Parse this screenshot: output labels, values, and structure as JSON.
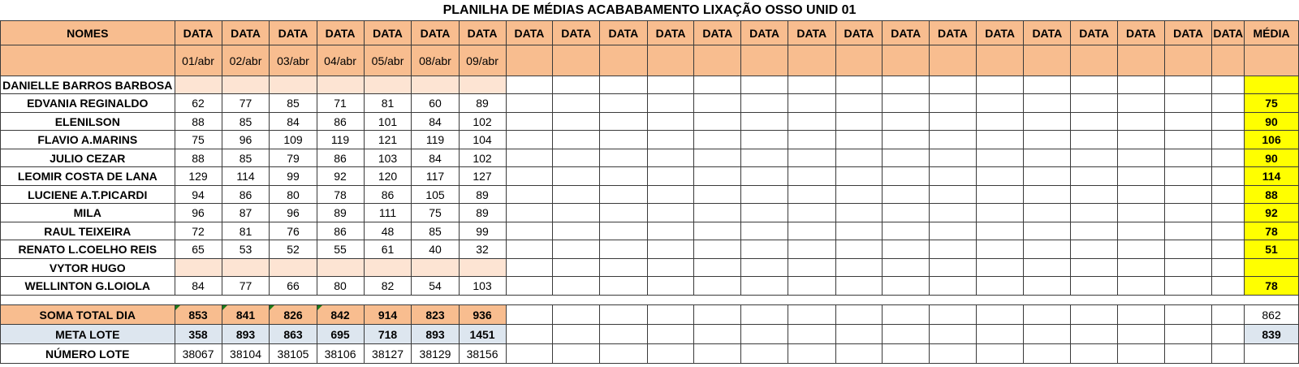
{
  "title": "PLANILHA DE MÉDIAS ACABABAMENTO LIXAÇÃO OSSO UNID 01",
  "header": {
    "names_label": "NOMES",
    "data_label": "DATA",
    "media_label": "MÉDIA",
    "dates": [
      "01/abr",
      "02/abr",
      "03/abr",
      "04/abr",
      "05/abr",
      "08/abr",
      "09/abr"
    ]
  },
  "rows": [
    {
      "name": "DANIELLE BARROS BARBOSA",
      "values": [
        "",
        "",
        "",
        "",
        "",
        "",
        ""
      ],
      "avg": ""
    },
    {
      "name": "EDVANIA REGINALDO",
      "values": [
        "62",
        "77",
        "85",
        "71",
        "81",
        "60",
        "89"
      ],
      "avg": "75"
    },
    {
      "name": "ELENILSON",
      "values": [
        "88",
        "85",
        "84",
        "86",
        "101",
        "84",
        "102"
      ],
      "avg": "90"
    },
    {
      "name": "FLAVIO A.MARINS",
      "values": [
        "75",
        "96",
        "109",
        "119",
        "121",
        "119",
        "104"
      ],
      "avg": "106"
    },
    {
      "name": "JULIO CEZAR",
      "values": [
        "88",
        "85",
        "79",
        "86",
        "103",
        "84",
        "102"
      ],
      "avg": "90"
    },
    {
      "name": "LEOMIR COSTA DE LANA",
      "values": [
        "129",
        "114",
        "99",
        "92",
        "120",
        "117",
        "127"
      ],
      "avg": "114"
    },
    {
      "name": "LUCIENE A.T.PICARDI",
      "values": [
        "94",
        "86",
        "80",
        "78",
        "86",
        "105",
        "89"
      ],
      "avg": "88"
    },
    {
      "name": "MILA",
      "values": [
        "96",
        "87",
        "96",
        "89",
        "111",
        "75",
        "89"
      ],
      "avg": "92"
    },
    {
      "name": "RAUL TEIXEIRA",
      "values": [
        "72",
        "81",
        "76",
        "86",
        "48",
        "85",
        "99"
      ],
      "avg": "78"
    },
    {
      "name": "RENATO L.COELHO REIS",
      "values": [
        "65",
        "53",
        "52",
        "55",
        "61",
        "40",
        "32"
      ],
      "avg": "51"
    },
    {
      "name": "VYTOR HUGO",
      "values": [
        "",
        "",
        "",
        "",
        "",
        "",
        ""
      ],
      "avg": ""
    },
    {
      "name": "WELLINTON G.LOIOLA",
      "values": [
        "84",
        "77",
        "66",
        "80",
        "82",
        "54",
        "103"
      ],
      "avg": "78"
    }
  ],
  "totals": {
    "soma": {
      "label": "SOMA TOTAL DIA",
      "values": [
        "853",
        "841",
        "826",
        "842",
        "914",
        "823",
        "936"
      ],
      "avg": "862"
    },
    "meta": {
      "label": "META LOTE",
      "values": [
        "358",
        "893",
        "863",
        "695",
        "718",
        "893",
        "1451"
      ],
      "avg": "839"
    },
    "lote": {
      "label": "NÚMERO LOTE",
      "values": [
        "38067",
        "38104",
        "38105",
        "38106",
        "38127",
        "38129",
        "38156"
      ]
    }
  },
  "colors": {
    "header_bg": "#f8bd8f",
    "empty_row_bg": "#fde4d3",
    "average_bg": "#ffff00",
    "meta_bg": "#dde6ef"
  }
}
